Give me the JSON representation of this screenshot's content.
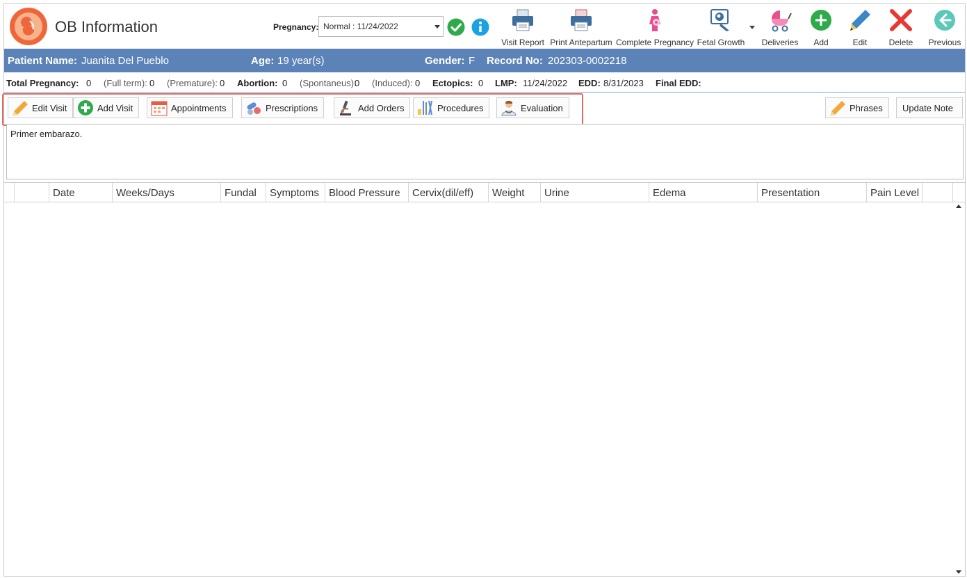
{
  "app": {
    "title": "OB Information"
  },
  "pregnancy": {
    "label": "Pregnancy:",
    "selected": "Normal : 11/24/2022"
  },
  "toolbar": {
    "visit_report": "Visit Report",
    "print_antepartum": "Print Antepartum",
    "complete_pregnancy": "Complete Pregnancy",
    "fetal_growth": "Fetal Growth",
    "deliveries": "Deliveries",
    "add": "Add",
    "edit": "Edit",
    "delete": "Delete",
    "previous": "Previous"
  },
  "patient": {
    "name_label": "Patient Name:",
    "name": "Juanita Del Pueblo",
    "age_label": "Age:",
    "age": "19 year(s)",
    "gender_label": "Gender:",
    "gender": "F",
    "record_label": "Record No:",
    "record": "202303-0002218"
  },
  "stats": {
    "total_label": "Total Pregnancy:",
    "total": "0",
    "full_term_label": "(Full term):",
    "full_term": "0",
    "premature_label": "(Premature):",
    "premature": "0",
    "abortion_label": "Abortion:",
    "abortion": "0",
    "spontaneus_label": "(Spontaneus):",
    "spontaneus": "0",
    "induced_label": "(Induced):",
    "induced": "0",
    "ectopics_label": "Ectopics:",
    "ectopics": "0",
    "lmp_label": "LMP:",
    "lmp": "11/24/2022",
    "edd_label": "EDD:",
    "edd": "8/31/2023",
    "final_edd_label": "Final EDD:",
    "final_edd": ""
  },
  "actions": {
    "edit_visit": "Edit Visit",
    "add_visit": "Add Visit",
    "appointments": "Appointments",
    "prescriptions": "Prescriptions",
    "add_orders": "Add Orders",
    "procedures": "Procedures",
    "evaluation": "Evaluation",
    "phrases": "Phrases",
    "update_note": "Update Note"
  },
  "note": {
    "text": "Primer embarazo."
  },
  "grid": {
    "columns": [
      "",
      "",
      "Date",
      "Weeks/Days",
      "Fundal",
      "Symptoms",
      "Blood Pressure",
      "Cervix(dil/eff)",
      "Weight",
      "Urine",
      "Edema",
      "Presentation",
      "Pain Level",
      ""
    ],
    "rows": []
  },
  "colors": {
    "patient_bar": "#5b83b7",
    "highlight": "#e06a5e",
    "accent_green": "#2eaa4a",
    "accent_blue": "#1aa3e0"
  }
}
